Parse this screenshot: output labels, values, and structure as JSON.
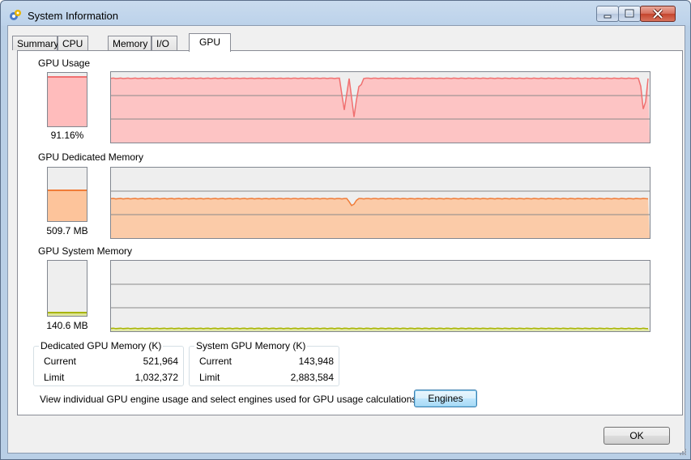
{
  "window": {
    "title": "System Information"
  },
  "tabs": [
    {
      "label": "Summary"
    },
    {
      "label": "CPU"
    },
    {
      "label": "Memory"
    },
    {
      "label": "I/O"
    },
    {
      "label": "GPU"
    }
  ],
  "active_tab": "GPU",
  "sections": {
    "gpu_usage": {
      "title": "GPU Usage",
      "value": "91.16%",
      "level": 0.9116,
      "color": "#ffbcbc",
      "line_color": "#f07070"
    },
    "dedicated": {
      "title": "GPU Dedicated Memory",
      "value": "509.7 MB",
      "level": 0.56,
      "color": "#fdc49b",
      "line_color": "#f07c38"
    },
    "system": {
      "title": "GPU System Memory",
      "value": "140.6 MB",
      "level": 0.04,
      "color": "#dde59a",
      "line_color": "#a8b400"
    }
  },
  "dedicated_group": {
    "title": "Dedicated GPU Memory (K)",
    "current_label": "Current",
    "current_value": "521,964",
    "limit_label": "Limit",
    "limit_value": "1,032,372"
  },
  "system_group": {
    "title": "System GPU Memory (K)",
    "current_label": "Current",
    "current_value": "143,948",
    "limit_label": "Limit",
    "limit_value": "2,883,584"
  },
  "engines_prompt": "View individual GPU engine usage and select engines used for GPU usage calculations:",
  "buttons": {
    "engines": "Engines",
    "ok": "OK"
  },
  "icons": {
    "app": "system-information-icon",
    "minimize": "minimize-icon",
    "maximize": "maximize-icon",
    "close": "close-icon"
  }
}
